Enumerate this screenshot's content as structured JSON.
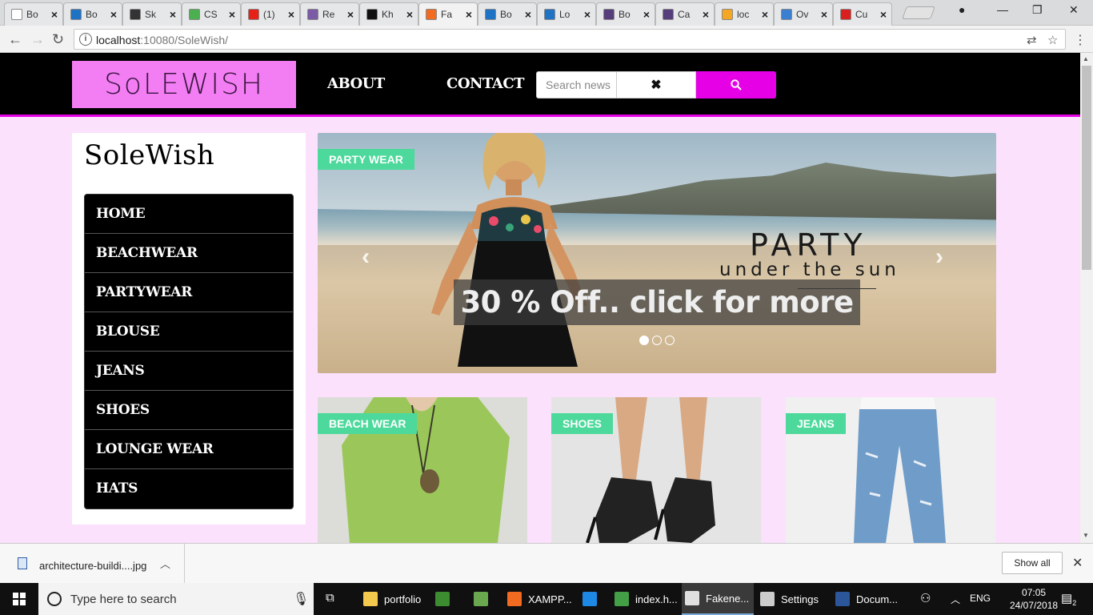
{
  "browser": {
    "tabs": [
      {
        "label": "Bo",
        "fav_color": "#ffffff"
      },
      {
        "label": "Bo",
        "fav_color": "#1f73c4"
      },
      {
        "label": "Sk",
        "fav_color": "#333333"
      },
      {
        "label": "CS",
        "fav_color": "#4caf50"
      },
      {
        "label": "(1)",
        "fav_color": "#e62117"
      },
      {
        "label": "Re",
        "fav_color": "#7b5aa6"
      },
      {
        "label": "Kh",
        "fav_color": "#111111"
      },
      {
        "label": "Fa",
        "fav_color": "#f26b21"
      },
      {
        "label": "Bo",
        "fav_color": "#1f73c4"
      },
      {
        "label": "Lo",
        "fav_color": "#1f73c4"
      },
      {
        "label": "Bo",
        "fav_color": "#563d7c"
      },
      {
        "label": "Ca",
        "fav_color": "#563d7c"
      },
      {
        "label": "loc",
        "fav_color": "#f5a623"
      },
      {
        "label": "Ov",
        "fav_color": "#3b7fd1"
      },
      {
        "label": "Cu",
        "fav_color": "#d9201e"
      }
    ],
    "active_tab_index": 7,
    "url_host": "localhost",
    "url_rest": ":10080/SoleWish/"
  },
  "header": {
    "logo_text": "SoLEWISH",
    "nav": [
      "ABOUT",
      "CONTACT"
    ],
    "search_placeholder": "Search news",
    "clear_symbol": "✖"
  },
  "sidebar": {
    "brand": "SoleWish",
    "menu": [
      "HOME",
      "BEACHWEAR",
      "PARTYWEAR",
      "BLOUSE",
      "JEANS",
      "SHOES",
      "LOUNGE WEAR",
      "HATS"
    ]
  },
  "carousel": {
    "tag": "PARTY WEAR",
    "headline": "PARTY",
    "subline": "under the sun",
    "promo": "30 % Off.. click for more",
    "prev_symbol": "‹",
    "next_symbol": "›",
    "slides": 3,
    "active_slide": 0
  },
  "cards": [
    {
      "tag": "BEACH WEAR"
    },
    {
      "tag": "SHOES"
    },
    {
      "tag": "JEANS"
    }
  ],
  "download": {
    "filename": "architecture-buildi....jpg",
    "show_all": "Show all"
  },
  "taskbar": {
    "search_text": "Type here to search",
    "apps": [
      {
        "label": "portfolio",
        "color": "#f2c94c"
      },
      {
        "label": "",
        "color": "#3c8d2f"
      },
      {
        "label": "",
        "color": "#6aa84f"
      },
      {
        "label": "XAMPP...",
        "color": "#f26b21"
      },
      {
        "label": "",
        "color": "#1e88e5"
      },
      {
        "label": "index.h...",
        "color": "#43a047"
      },
      {
        "label": "Fakene...",
        "color": "#e0e0e0"
      },
      {
        "label": "Settings",
        "color": "#cccccc"
      },
      {
        "label": "Docum...",
        "color": "#2b579a"
      }
    ],
    "language": "ENG",
    "time": "07:05",
    "date": "24/07/2018",
    "notifications": "2"
  }
}
